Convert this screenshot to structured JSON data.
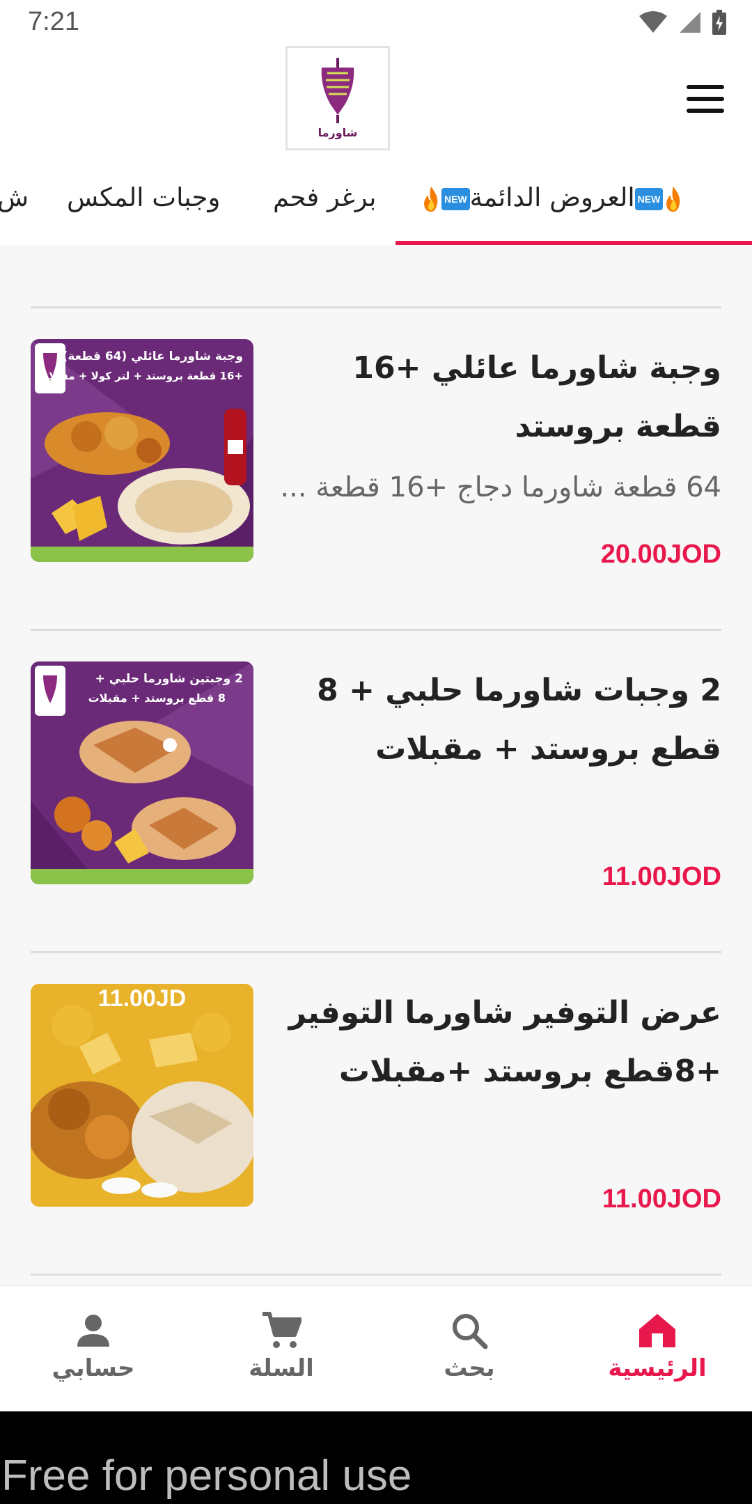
{
  "status_bar": {
    "time": "7:21"
  },
  "header": {
    "logo_text": "شاورما"
  },
  "tabs": [
    {
      "label": "العروض الدائمة"
    },
    {
      "label": "برغر فحم"
    },
    {
      "label": "وجبات المكس"
    },
    {
      "label": "ش"
    }
  ],
  "tab_badge": "NEW",
  "items": [
    {
      "title": "وجبة شاورما عائلي +16 قطعة بروستد",
      "description": "64 قطعة شاورما دجاج +16 قطعة ...",
      "price": "20.00JOD",
      "image_caption_1": "وجبة شاورما عائلي (64 قطعة)",
      "image_caption_2": "+16 قطعة بروستد + لتر كولا + مقبلات"
    },
    {
      "title": "2 وجبات شاورما حلبي + 8 قطع بروستد + مقبلات",
      "description": "",
      "price": "11.00JOD",
      "image_caption_1": "2 وجبتين شاورما حلبي +",
      "image_caption_2": "8 قطع بروستد + مقبلات"
    },
    {
      "title": "عرض التوفير شاورما التوفير +8قطع بروستد +مقبلات",
      "description": "",
      "price": "11.00JOD",
      "image_caption_1": "11.00JD",
      "image_caption_2": ""
    }
  ],
  "bottom_nav": [
    {
      "label": "الرئيسية",
      "icon": "home-icon"
    },
    {
      "label": "بحث",
      "icon": "search-icon"
    },
    {
      "label": "السلة",
      "icon": "cart-icon"
    },
    {
      "label": "حسابي",
      "icon": "account-icon"
    }
  ],
  "watermark": "Free for personal use",
  "colors": {
    "accent": "#e8174c",
    "badge": "#2a8fe0",
    "purple": "#6a1b5c"
  }
}
